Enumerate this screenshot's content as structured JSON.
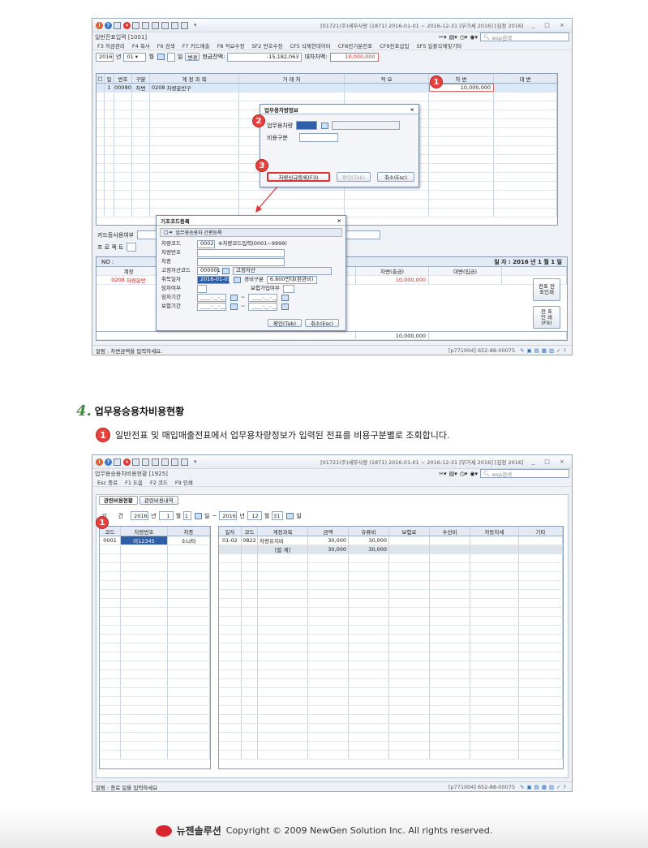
{
  "win1": {
    "title": "[01721(주)세무사랑 (1871) 2016-01-01 ~ 2016-12-31 [부가세 2016] [김정 2016]",
    "app_name": "일반전표입력 [1001]",
    "search_placeholder": "wsp검색",
    "menu": [
      "F3 자금관리",
      "F4 복사",
      "F6 검색",
      "F7 카드매출",
      "F8 적요수정",
      "SF2 번호수정",
      "CF5 삭제한데이터",
      "CF8전기분전표",
      "CF9전표삽입",
      "SF5 일괄삭제및기타"
    ],
    "year": "2016",
    "year_suffix": "년",
    "month": "01",
    "month_suffix": "월",
    "day_suffix": "일",
    "day_btn": "변경",
    "cash_label": "현금잔액:",
    "cash_value": "-15,182,063",
    "diff_label": "대차차액:",
    "diff_value": "10,000,000",
    "cols": [
      "□",
      "일",
      "번호",
      "구분",
      "계 정 과 목",
      "거 래 처",
      "적 요",
      "차 변",
      "대 변"
    ],
    "row": {
      "day": "1",
      "no": "00080",
      "type": "차변",
      "code": "0208",
      "account": "차량운반구",
      "debit": "10,000,000"
    },
    "card_label": "카드등사용여부",
    "project_label": "프 로 젝 트",
    "lower": {
      "no_label": "NO :",
      "date": "일 자 : 2016 년 1 월 1 일",
      "account_col": "계정",
      "debit_col": "차변(출금)",
      "credit_col": "대변(입금)",
      "code": "0208",
      "name": "차량운반",
      "amount": "10,000,000",
      "total": "10,000,000",
      "btn1": "전표 전표인쇄",
      "btn2": "전 표 인 쇄(F9)"
    },
    "status": "알림 : 차변금액을 입력하세요.",
    "status_right": "[p771004] 652-88-00075"
  },
  "dlg1": {
    "title": "업무용차량정보",
    "car_label": "업무용차량",
    "cost_label": "비용구분",
    "btn_new": "차량신규등록(F3)",
    "btn_ok": "확인(Tab)",
    "btn_cancel": "취소(Esc)"
  },
  "dlg2": {
    "title": "기초코드등록",
    "sub": "업무용승용차 간편등록",
    "car_code_label": "차량코드",
    "car_code": "0002",
    "car_code_hint": "※차량코드입력(0001~9999)",
    "car_no_label": "차량번호",
    "car_type_label": "차종",
    "asset_code_label": "고정자산코드",
    "asset_code": "000001",
    "asset_name": "고정자산",
    "acq_date_label": "취득일자",
    "acq_date": "2016-01-01",
    "cost_type_label": "경비구분",
    "cost_type": "6.800번대(판관비)",
    "lease_label": "임차여부",
    "insurance_label": "보험가입여부",
    "lease_period_label": "임차기간",
    "ins_period_label": "보험기간",
    "date_blank": "____-__-__",
    "btn_ok": "확인(Tab)",
    "btn_cancel": "취소(Esc)"
  },
  "badges": {
    "b1": "1",
    "b2": "2",
    "b3": "3"
  },
  "section": {
    "num": "4.",
    "title": "업무용승용차비용현황",
    "badge": "1",
    "desc": "일반전표 및 매입매출전표에서 업무용차량정보가 입력된 전표를 비용구분별로 조회합니다."
  },
  "win2": {
    "title": "[01721(주)세무사랑 (1871) 2016-01-01 ~ 2016-12-31 [부가세 2016] [김정 2016]",
    "app_name": "업무용승용차비용현황 [1925]",
    "search_placeholder": "wsp검색",
    "menu": [
      "Esc 종료",
      "F1 도움",
      "F2 코드",
      "F9 인쇄"
    ],
    "tabs": [
      "관련비용현황",
      "관련비용내역"
    ],
    "period_label": "기 간",
    "y1": "2016",
    "m1": "1",
    "d1": "1",
    "y2": "2016",
    "m2": "12",
    "d2": "31",
    "year_suffix": "년",
    "month_suffix": "월",
    "day_suffix": "일",
    "lcols": [
      "코드",
      "차량번호",
      "차종"
    ],
    "lrow": {
      "code": "0001",
      "no": "러12345",
      "type": "소나타"
    },
    "rcols": [
      "일자",
      "코드",
      "계정과목",
      "금액",
      "유류비",
      "보험료",
      "수선비",
      "자동차세",
      "기타"
    ],
    "rrow1": {
      "date": "01-02",
      "code": "0822",
      "account": "차량유지비",
      "amount": "30,000",
      "fuel": "30,000"
    },
    "rrow2": {
      "account": "[합 계]",
      "amount": "30,000",
      "fuel": "30,000"
    },
    "status": "알림 : 종료 일을 입력하세요",
    "status_right": "[p771004] 652-88-00075"
  },
  "footer": {
    "brand": "뉴젠솔루션",
    "copyright": "Copyright © 2009 NewGen Solution Inc. All rights reserved."
  }
}
